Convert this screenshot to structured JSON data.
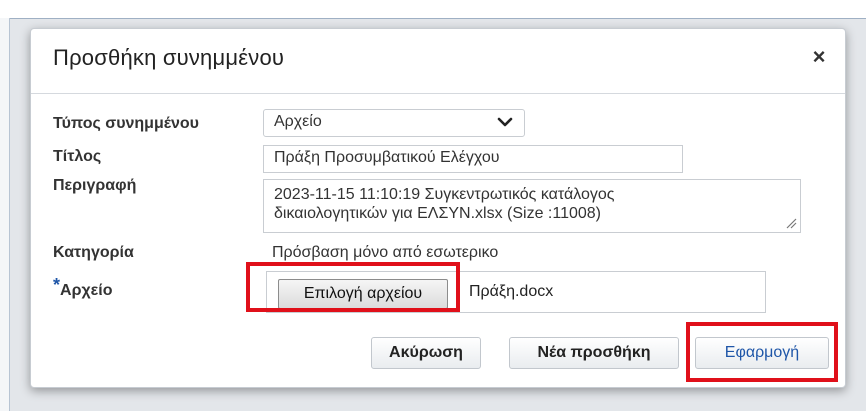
{
  "dialog": {
    "title": "Προσθήκη συνημμένου",
    "close_glyph": "×"
  },
  "form": {
    "type_label": "Τύπος συνημμένου",
    "type_value": "Αρχείο",
    "title_label": "Τίτλος",
    "title_value": "Πράξη Προσυμβατικού Ελέγχου",
    "description_label": "Περιγραφή",
    "description_line1": "2023-11-15 11:10:19 Συγκεντρωτικός κατάλογος",
    "description_line2": "δικαιολογητικών για ΕΛΣΥΝ.xlsx (Size :11008)",
    "category_label": "Κατηγορία",
    "category_value": "Πρόσβαση μόνο από εσωτερικο",
    "file_label": "Αρχείο",
    "required_marker": "*",
    "file_button": "Επιλογή αρχείου",
    "file_name": "Πράξη.docx"
  },
  "actions": {
    "cancel": "Ακύρωση",
    "add_new": "Νέα προσθήκη",
    "apply": "Εφαρμογή"
  },
  "colors": {
    "highlight": "#e0101a",
    "primary_text": "#1f56a8"
  },
  "icons": {
    "close": "close-icon",
    "dropdown": "chevron-down-icon",
    "resize": "resize-grip-icon"
  }
}
